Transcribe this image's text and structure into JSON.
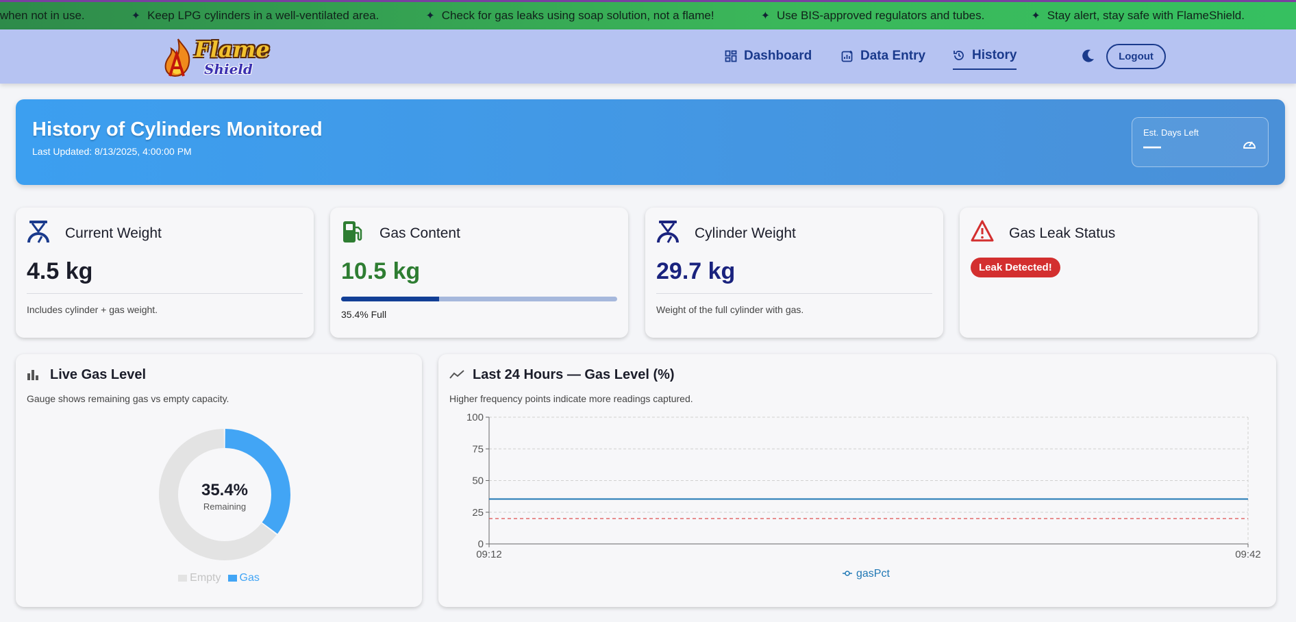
{
  "ticker": {
    "items": [
      "or when not in use.",
      "Keep LPG cylinders in a well-ventilated area.",
      "Check for gas leaks using soap solution, not a flame!",
      "Use BIS-approved regulators and tubes.",
      "Stay alert, stay safe with FlameShield."
    ]
  },
  "brand": {
    "logo_top": "Flame",
    "logo_bottom": "Shield"
  },
  "nav": {
    "dashboard": "Dashboard",
    "data_entry": "Data Entry",
    "history": "History",
    "logout": "Logout",
    "active": "history"
  },
  "hero": {
    "title": "History of Cylinders Monitored",
    "last_updated": "Last Updated: 8/13/2025, 4:00:00 PM",
    "days_label": "Est. Days Left",
    "days_value": "—"
  },
  "stats": {
    "current_weight": {
      "title": "Current Weight",
      "value": "4.5 kg",
      "note": "Includes cylinder + gas weight."
    },
    "gas_content": {
      "title": "Gas Content",
      "value": "10.5 kg",
      "fill_fraction": 0.354,
      "note": "35.4% Full"
    },
    "cylinder_weight": {
      "title": "Cylinder Weight",
      "value": "29.7 kg",
      "note": "Weight of the full cylinder with gas."
    },
    "leak": {
      "title": "Gas Leak Status",
      "badge": "Leak Detected!"
    }
  },
  "live_gas": {
    "title": "Live Gas Level",
    "subtitle": "Gauge shows remaining gas vs empty capacity.",
    "center_value": "35.4%",
    "center_label": "Remaining"
  },
  "history_chart": {
    "title": "Last 24 Hours — Gas Level (%)",
    "subtitle": "Higher frequency points indicate more readings captured."
  },
  "colors": {
    "accent": "#1a3a8c",
    "gas": "#42a5f5",
    "empty": "#e3e3e3",
    "leak": "#d32f2f",
    "gas_content": "#2e7d32",
    "line": "#1f77b4",
    "threshold": "#e05050"
  },
  "chart_data": [
    {
      "type": "pie",
      "categories": [
        "Empty",
        "Gas"
      ],
      "values": [
        64.6,
        35.4
      ],
      "legend_position": "bottom"
    },
    {
      "type": "line",
      "x": [
        "09:12",
        "09:42"
      ],
      "series": [
        {
          "name": "gasPct",
          "values": [
            35.4,
            35.4
          ]
        }
      ],
      "threshold": 20,
      "ylim": [
        0,
        100
      ],
      "yticks": [
        0,
        25,
        50,
        75,
        100
      ],
      "grid": true,
      "legend_position": "bottom"
    }
  ]
}
